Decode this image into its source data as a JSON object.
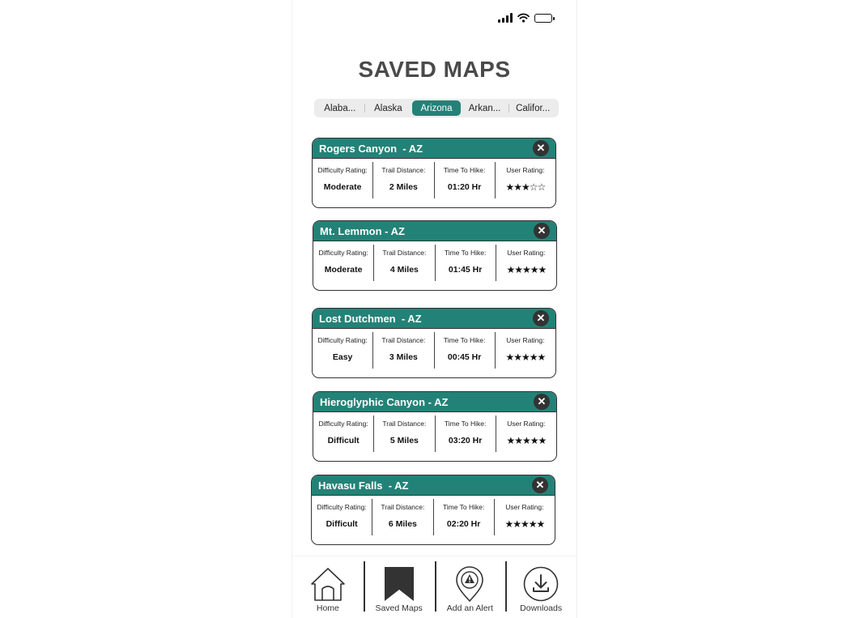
{
  "header": {
    "title": "SAVED MAPS"
  },
  "tabs": [
    {
      "label": "Alaba..."
    },
    {
      "label": "Alaska"
    },
    {
      "label": "Arizona"
    },
    {
      "label": "Arkan..."
    },
    {
      "label": "Califor..."
    }
  ],
  "active_tab": "Arizona",
  "labels": {
    "difficulty": "Difficulty Rating:",
    "distance": "Trail Distance:",
    "time": "Time To Hike:",
    "rating": "User Rating:"
  },
  "trails": [
    {
      "title": "Rogers Canyon  - AZ",
      "difficulty": "Moderate",
      "distance": "2 Miles",
      "time": "01:20 Hr",
      "stars": "★★★☆☆",
      "rating": 3
    },
    {
      "title": "Mt. Lemmon - AZ",
      "difficulty": "Moderate",
      "distance": "4 Miles",
      "time": "01:45 Hr",
      "stars": "★★★★★",
      "rating": 5
    },
    {
      "title": "Lost Dutchmen  - AZ",
      "difficulty": "Easy",
      "distance": "3 Miles",
      "time": "00:45 Hr",
      "stars": "★★★★★",
      "rating": 5
    },
    {
      "title": "Hieroglyphic Canyon - AZ",
      "difficulty": "Difficult",
      "distance": "5 Miles",
      "time": "03:20 Hr",
      "stars": "★★★★★",
      "rating": 5
    },
    {
      "title": "Havasu Falls  - AZ",
      "difficulty": "Difficult",
      "distance": "6 Miles",
      "time": "02:20 Hr",
      "stars": "★★★★★",
      "rating": 5
    }
  ],
  "close_glyph": "✕",
  "nav": [
    {
      "label": "Home",
      "icon": "home-icon"
    },
    {
      "label": "Saved Maps",
      "icon": "bookmark-icon"
    },
    {
      "label": "Add an Alert",
      "icon": "alert-pin-icon"
    },
    {
      "label": "Downloads",
      "icon": "download-icon"
    }
  ],
  "colors": {
    "accent": "#238277",
    "dark": "#333333"
  }
}
